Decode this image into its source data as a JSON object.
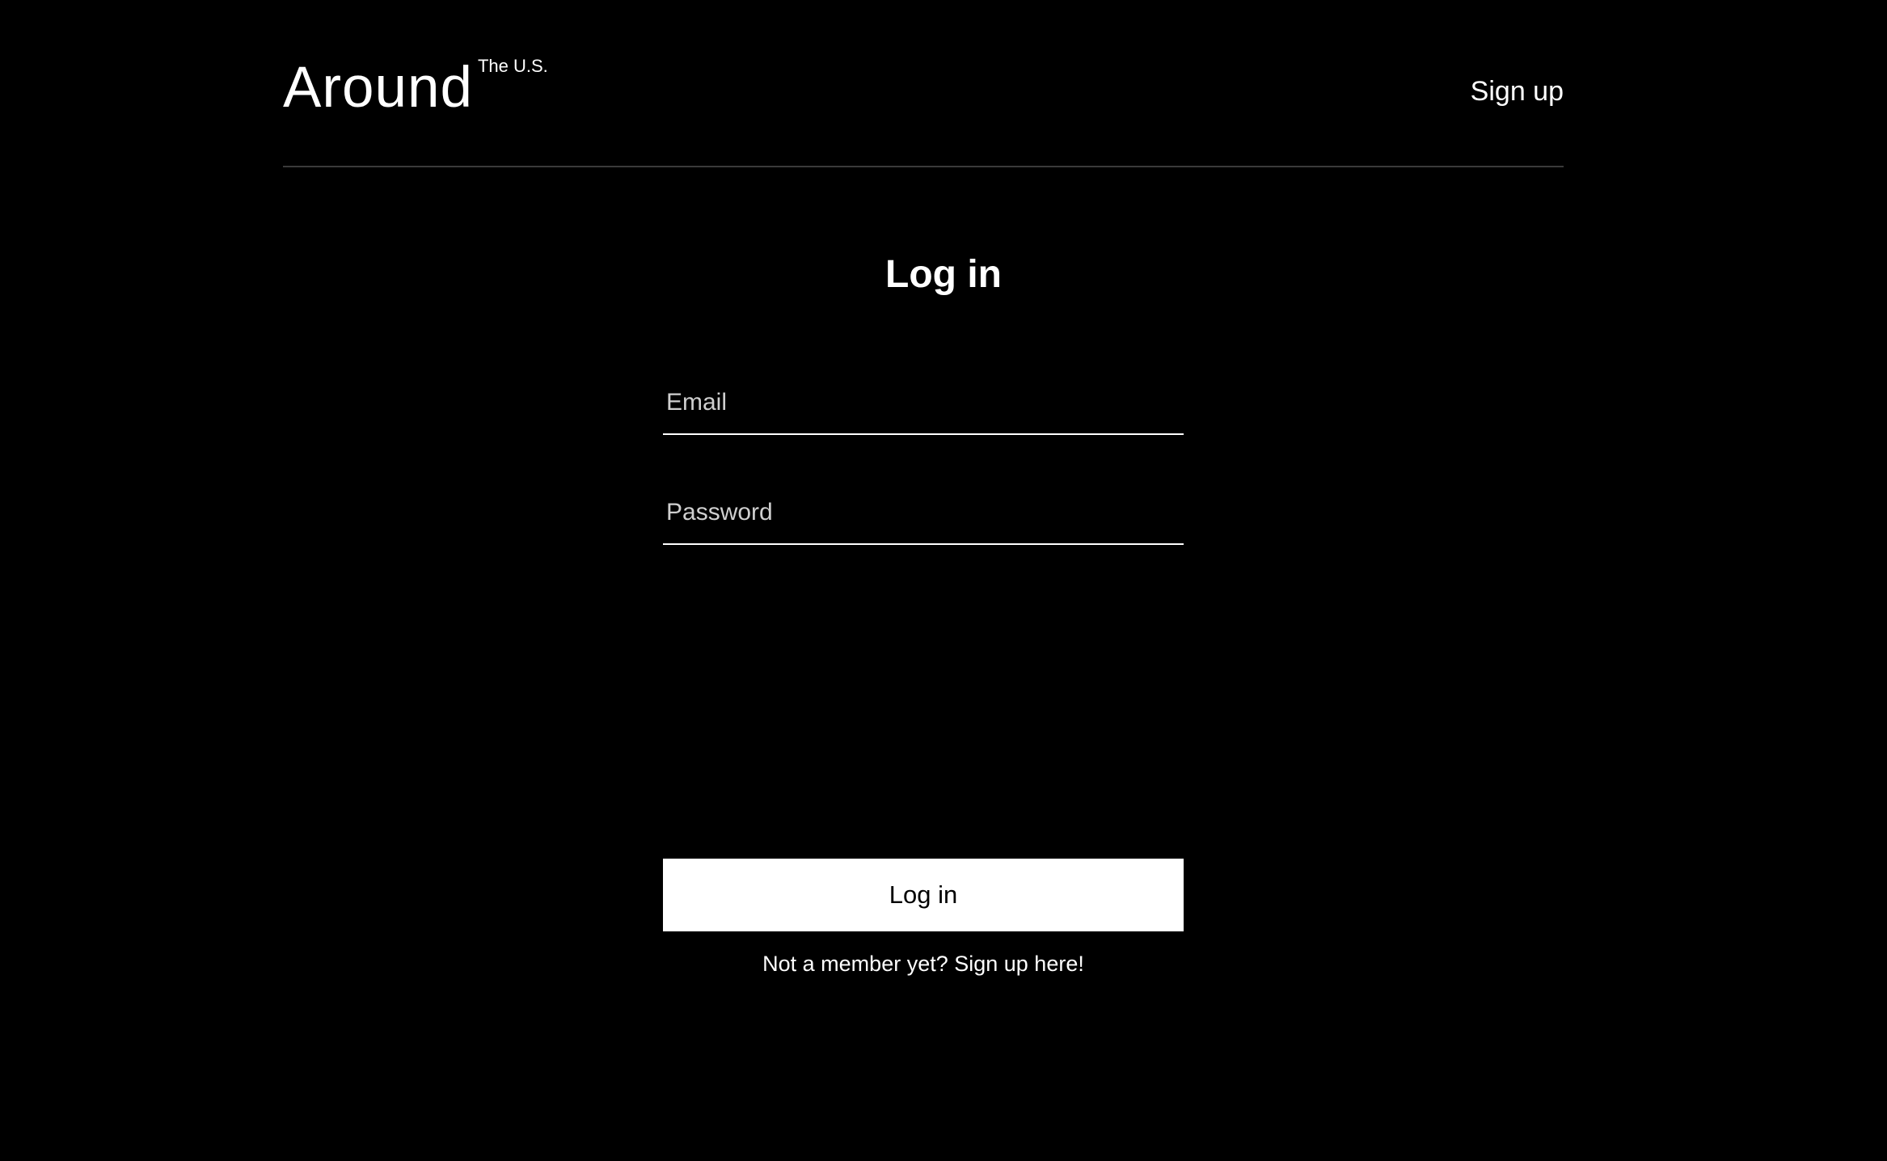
{
  "header": {
    "logo_text": "Around",
    "logo_superscript": "The U.S.",
    "nav_signup_label": "Sign up"
  },
  "login_form": {
    "title": "Log in",
    "email_placeholder": "Email",
    "password_placeholder": "Password",
    "submit_label": "Log in",
    "signup_prompt": "Not a member yet? Sign up here!"
  },
  "colors": {
    "background": "#000000",
    "text": "#ffffff",
    "button_background": "#ffffff",
    "button_text": "#000000",
    "divider": "#3a3a3a"
  }
}
